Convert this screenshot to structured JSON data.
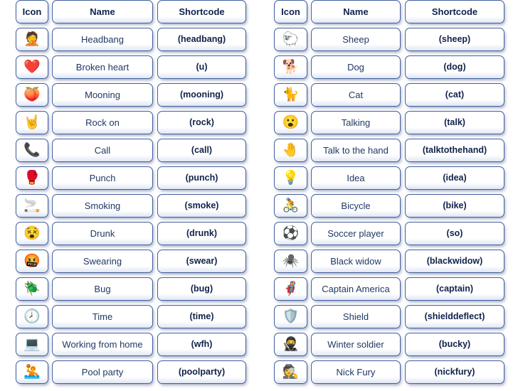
{
  "page": {
    "background_color": "#ffffff",
    "text_color": "#1f3864",
    "border_color": "#415e9e"
  },
  "tables": [
    {
      "id": "left",
      "headers": {
        "icon": "Icon",
        "name": "Name",
        "shortcode": "Shortcode"
      },
      "rows": [
        {
          "icon_glyph": "🤦",
          "icon_name": "headbang-emoji-icon",
          "name": "Headbang",
          "shortcode": "(headbang)"
        },
        {
          "icon_glyph": "❤️",
          "icon_name": "broken-heart-emoji-icon",
          "name": "Broken heart",
          "shortcode": "(u)"
        },
        {
          "icon_glyph": "🍑",
          "icon_name": "mooning-emoji-icon",
          "name": "Mooning",
          "shortcode": "(mooning)"
        },
        {
          "icon_glyph": "🤘",
          "icon_name": "rock-on-emoji-icon",
          "name": "Rock on",
          "shortcode": "(rock)"
        },
        {
          "icon_glyph": "📞",
          "icon_name": "call-emoji-icon",
          "name": "Call",
          "shortcode": "(call)"
        },
        {
          "icon_glyph": "🥊",
          "icon_name": "punch-emoji-icon",
          "name": "Punch",
          "shortcode": "(punch)"
        },
        {
          "icon_glyph": "🚬",
          "icon_name": "smoking-emoji-icon",
          "name": "Smoking",
          "shortcode": "(smoke)"
        },
        {
          "icon_glyph": "😵",
          "icon_name": "drunk-emoji-icon",
          "name": "Drunk",
          "shortcode": "(drunk)"
        },
        {
          "icon_glyph": "🤬",
          "icon_name": "swearing-emoji-icon",
          "name": "Swearing",
          "shortcode": "(swear)"
        },
        {
          "icon_glyph": "🪲",
          "icon_name": "bug-emoji-icon",
          "name": "Bug",
          "shortcode": "(bug)"
        },
        {
          "icon_glyph": "🕗",
          "icon_name": "time-clock-emoji-icon",
          "name": "Time",
          "shortcode": "(time)"
        },
        {
          "icon_glyph": "💻",
          "icon_name": "laptop-emoji-icon",
          "name": "Working from home",
          "shortcode": "(wfh)"
        },
        {
          "icon_glyph": "🤽",
          "icon_name": "pool-party-emoji-icon",
          "name": "Pool party",
          "shortcode": "(poolparty)"
        }
      ]
    },
    {
      "id": "right",
      "headers": {
        "icon": "Icon",
        "name": "Name",
        "shortcode": "Shortcode"
      },
      "rows": [
        {
          "icon_glyph": "🐑",
          "icon_name": "sheep-emoji-icon",
          "name": "Sheep",
          "shortcode": "(sheep)"
        },
        {
          "icon_glyph": "🐕",
          "icon_name": "dog-emoji-icon",
          "name": "Dog",
          "shortcode": "(dog)"
        },
        {
          "icon_glyph": "🐈",
          "icon_name": "cat-emoji-icon",
          "name": "Cat",
          "shortcode": "(cat)"
        },
        {
          "icon_glyph": "😮",
          "icon_name": "talking-emoji-icon",
          "name": "Talking",
          "shortcode": "(talk)"
        },
        {
          "icon_glyph": "🤚",
          "icon_name": "talk-to-the-hand-emoji-icon",
          "name": "Talk to the hand",
          "shortcode": "(talktothehand)"
        },
        {
          "icon_glyph": "💡",
          "icon_name": "idea-lightbulb-emoji-icon",
          "name": "Idea",
          "shortcode": "(idea)"
        },
        {
          "icon_glyph": "🚴",
          "icon_name": "bicycle-emoji-icon",
          "name": "Bicycle",
          "shortcode": "(bike)"
        },
        {
          "icon_glyph": "⚽",
          "icon_name": "soccer-player-emoji-icon",
          "name": "Soccer player",
          "shortcode": "(so)"
        },
        {
          "icon_glyph": "🕷️",
          "icon_name": "black-widow-emoji-icon",
          "name": "Black widow",
          "shortcode": "(blackwidow)"
        },
        {
          "icon_glyph": "🦸",
          "icon_name": "captain-america-emoji-icon",
          "name": "Captain America",
          "shortcode": "(captain)"
        },
        {
          "icon_glyph": "🛡️",
          "icon_name": "shield-emoji-icon",
          "name": "Shield",
          "shortcode": "(shielddeflect)"
        },
        {
          "icon_glyph": "🥷",
          "icon_name": "winter-soldier-emoji-icon",
          "name": "Winter soldier",
          "shortcode": "(bucky)"
        },
        {
          "icon_glyph": "🕵️",
          "icon_name": "nick-fury-emoji-icon",
          "name": "Nick Fury",
          "shortcode": "(nickfury)"
        }
      ]
    }
  ]
}
